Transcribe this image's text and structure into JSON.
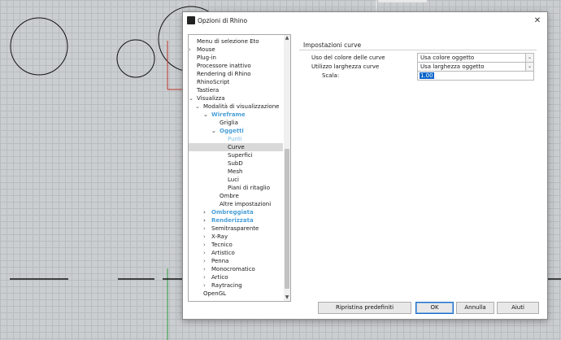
{
  "dialog": {
    "title": "Opzioni di Rhino",
    "close_symbol": "✕"
  },
  "tree": {
    "items": [
      {
        "label": "Menu di selezione Eto",
        "level": 0,
        "arrow": ""
      },
      {
        "label": "Mouse",
        "level": 0,
        "arrow": ">"
      },
      {
        "label": "Plug-in",
        "level": 0,
        "arrow": ""
      },
      {
        "label": "Processore inattivo",
        "level": 0,
        "arrow": ""
      },
      {
        "label": "Rendering di Rhino",
        "level": 0,
        "arrow": ""
      },
      {
        "label": "RhinoScript",
        "level": 0,
        "arrow": ""
      },
      {
        "label": "Tastiera",
        "level": 0,
        "arrow": ""
      },
      {
        "label": "Visualizza",
        "level": 0,
        "arrow": "v"
      },
      {
        "label": "Modalità di visualizzazione",
        "level": 1,
        "arrow": "v"
      },
      {
        "label": "Wireframe",
        "level": 2,
        "arrow": "v",
        "style": "accent"
      },
      {
        "label": "Griglia",
        "level": 3,
        "arrow": ""
      },
      {
        "label": "Oggetti",
        "level": 3,
        "arrow": "v",
        "style": "accent"
      },
      {
        "label": "Punti",
        "level": 4,
        "arrow": "",
        "style": "accent-light"
      },
      {
        "label": "Curve",
        "level": 4,
        "arrow": "",
        "selected": true
      },
      {
        "label": "Superfici",
        "level": 4,
        "arrow": ""
      },
      {
        "label": "SubD",
        "level": 4,
        "arrow": ""
      },
      {
        "label": "Mesh",
        "level": 4,
        "arrow": ""
      },
      {
        "label": "Luci",
        "level": 4,
        "arrow": ""
      },
      {
        "label": "Piani di ritaglio",
        "level": 4,
        "arrow": ""
      },
      {
        "label": "Ombre",
        "level": 3,
        "arrow": ""
      },
      {
        "label": "Altre impostazioni",
        "level": 3,
        "arrow": ""
      },
      {
        "label": "Ombreggiata",
        "level": 2,
        "arrow": ">",
        "style": "accent"
      },
      {
        "label": "Renderizzata",
        "level": 2,
        "arrow": ">",
        "style": "accent"
      },
      {
        "label": "Semitrasparente",
        "level": 2,
        "arrow": ">"
      },
      {
        "label": "X-Ray",
        "level": 2,
        "arrow": ">"
      },
      {
        "label": "Tecnico",
        "level": 2,
        "arrow": ">"
      },
      {
        "label": "Artistico",
        "level": 2,
        "arrow": ">"
      },
      {
        "label": "Penna",
        "level": 2,
        "arrow": ">"
      },
      {
        "label": "Monocromatico",
        "level": 2,
        "arrow": ">"
      },
      {
        "label": "Artico",
        "level": 2,
        "arrow": ">"
      },
      {
        "label": "Raytracing",
        "level": 2,
        "arrow": ">"
      },
      {
        "label": "OpenGL",
        "level": 1,
        "arrow": ""
      }
    ]
  },
  "panel": {
    "section_title": "Impostazioni curve",
    "color_label": "Uso del colore delle curve",
    "color_value": "Usa colore oggetto",
    "width_label": "Utilizzo larghezza curve",
    "width_value": "Usa larghezza oggetto",
    "scale_label": "Scala:",
    "scale_value": "1.00"
  },
  "buttons": {
    "restore": "Ripristina predefiniti",
    "ok": "OK",
    "cancel": "Annulla",
    "help": "Aiuti"
  },
  "colors": {
    "accent": "#4a9fd8",
    "selection": "#0a64c9"
  }
}
